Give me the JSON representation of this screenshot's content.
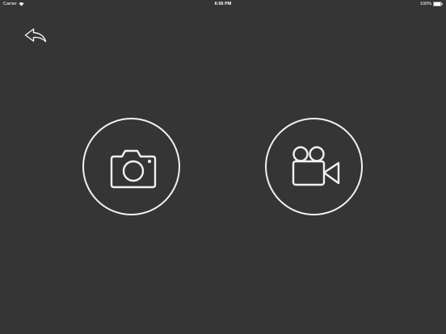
{
  "status_bar": {
    "carrier": "Carrier",
    "carrier_icon": "wifi-icon",
    "time": "6:56 PM",
    "battery_percent": "100%",
    "battery_icon": "battery-icon"
  },
  "toolbar": {
    "back_icon": "undo-arrow-icon"
  },
  "actions": {
    "camera_icon": "camera-icon",
    "video_icon": "video-camera-icon"
  },
  "colors": {
    "background": "#353535",
    "foreground": "#f2f2f2"
  }
}
